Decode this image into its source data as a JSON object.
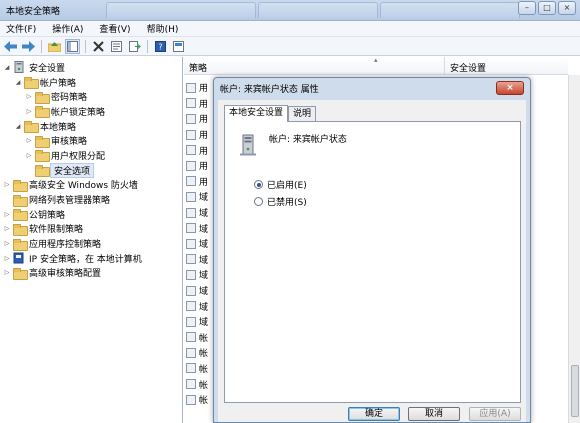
{
  "window": {
    "title": "本地安全策略"
  },
  "menu": [
    "文件(F)",
    "操作(A)",
    "查看(V)",
    "帮助(H)"
  ],
  "tree": [
    {
      "label": "安全设置",
      "level": 0,
      "arrow": "expanded",
      "icon": "security-settings-icon"
    },
    {
      "label": "帐户策略",
      "level": 1,
      "arrow": "expanded",
      "icon": "folder-icon"
    },
    {
      "label": "密码策略",
      "level": 2,
      "arrow": "collapsed",
      "icon": "folder-icon"
    },
    {
      "label": "帐户锁定策略",
      "level": 2,
      "arrow": "collapsed",
      "icon": "folder-icon"
    },
    {
      "label": "本地策略",
      "level": 1,
      "arrow": "expanded",
      "icon": "folder-icon"
    },
    {
      "label": "审核策略",
      "level": 2,
      "arrow": "collapsed",
      "icon": "folder-icon"
    },
    {
      "label": "用户权限分配",
      "level": 2,
      "arrow": "collapsed",
      "icon": "folder-icon"
    },
    {
      "label": "安全选项",
      "level": 2,
      "arrow": "none",
      "icon": "folder-icon",
      "selected": true
    },
    {
      "label": "高级安全 Windows 防火墙",
      "level": 0,
      "arrow": "collapsed",
      "icon": "folder-icon"
    },
    {
      "label": "网络列表管理器策略",
      "level": 0,
      "arrow": "none",
      "icon": "folder-icon"
    },
    {
      "label": "公钥策略",
      "level": 0,
      "arrow": "collapsed",
      "icon": "folder-icon"
    },
    {
      "label": "软件限制策略",
      "level": 0,
      "arrow": "collapsed",
      "icon": "folder-icon"
    },
    {
      "label": "应用程序控制策略",
      "level": 0,
      "arrow": "collapsed",
      "icon": "folder-icon"
    },
    {
      "label": "IP 安全策略，在 本地计算机",
      "level": 0,
      "arrow": "collapsed",
      "icon": "ip-policy-icon"
    },
    {
      "label": "高级审核策略配置",
      "level": 0,
      "arrow": "collapsed",
      "icon": "folder-icon"
    }
  ],
  "list": {
    "columns": [
      "策略",
      "安全设置"
    ],
    "rows": [
      "用",
      "用",
      "用",
      "用",
      "用",
      "用",
      "用",
      "域",
      "域",
      "域",
      "域",
      "域",
      "域",
      "域",
      "域",
      "域",
      "帐",
      "帐",
      "帐",
      "帐",
      "帐"
    ]
  },
  "dialog": {
    "title": "帐户: 来宾帐户状态 属性",
    "tabs": [
      "本地安全设置",
      "说明"
    ],
    "setting_name": "帐户: 来宾帐户状态",
    "option_enabled": "已启用(E)",
    "option_disabled": "已禁用(S)",
    "selected_option": "enabled",
    "ok": "确定",
    "cancel": "取消",
    "apply": "应用(A)"
  },
  "colors": {
    "accent": "#2a55a8",
    "dialog_frame": "#cfdcec",
    "folder": "#efcf74"
  }
}
